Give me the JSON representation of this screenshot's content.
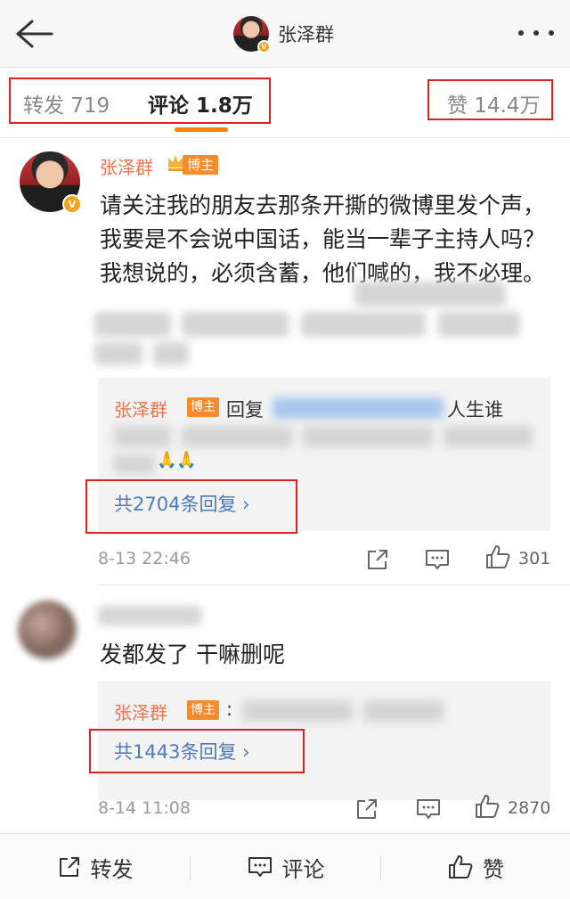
{
  "header": {
    "back_icon": "back-arrow-icon",
    "name": "张泽群",
    "verified_badge": "V",
    "more_icon": "more-dots-icon"
  },
  "tabs": {
    "repost": "转发 719",
    "comment": "评论 1.8万",
    "like": "赞 14.4万",
    "active_color": "#ff8200"
  },
  "comments": [
    {
      "author": "张泽群",
      "badge": "博主",
      "text": "请关注我的朋友去那条开撕的微博里发个声，我要是不会说中国话，能当一辈子主持人吗？我想说的，必须含蓄，他们喊的，我不必理。",
      "reply_preview": {
        "author": "张泽群",
        "badge": "博主",
        "prefix": "回复",
        "suffix": "人生谁",
        "emoji": "🙏🙏"
      },
      "more_replies": "共2704条回复 ›",
      "time": "8-13 22:46",
      "likes": "301"
    },
    {
      "author": "",
      "text": "发都发了 干嘛删呢",
      "reply_preview": {
        "author": "张泽群",
        "badge": "博主",
        "prefix": ":"
      },
      "more_replies": "共1443条回复 ›",
      "time": "8-14 11:08",
      "likes": "2870"
    }
  ],
  "bottom_bar": {
    "repost": "转发",
    "comment": "评论",
    "like": "赞"
  },
  "colors": {
    "name_orange": "#eb7350",
    "link_blue": "#4e7ab8",
    "badge_orange": "#f68b2c",
    "highlight_red": "#e02020"
  }
}
